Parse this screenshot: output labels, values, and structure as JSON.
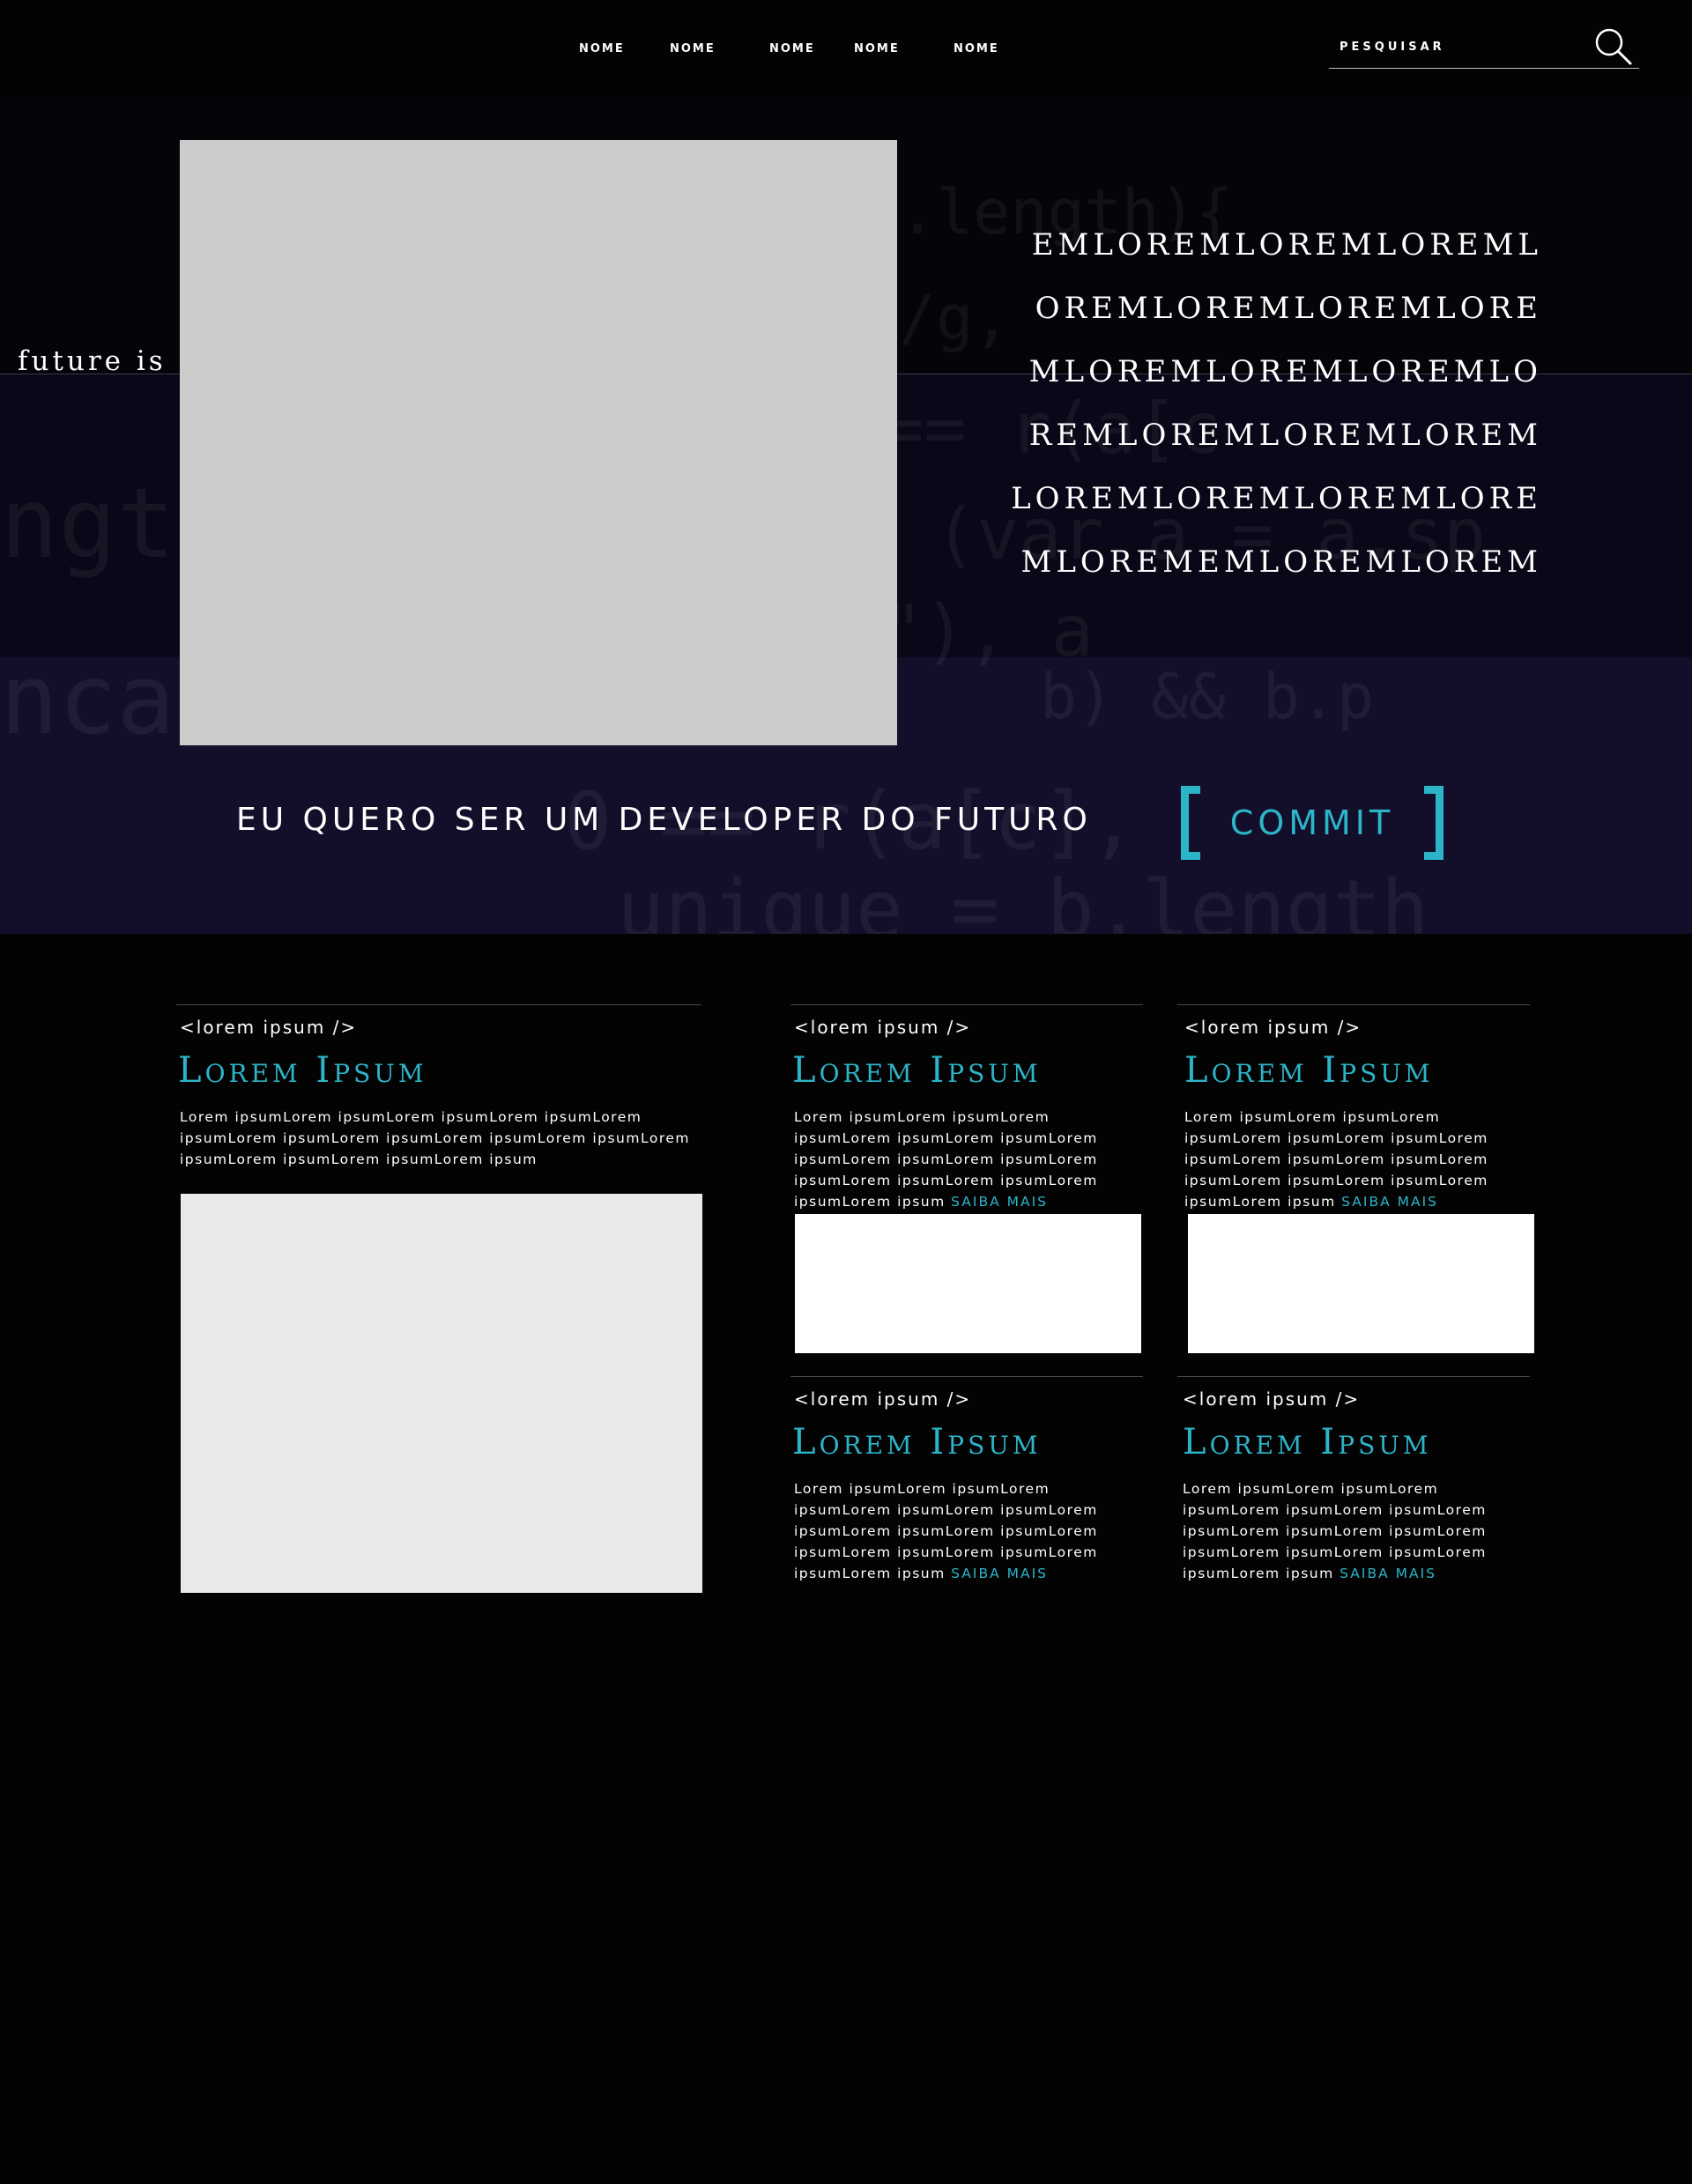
{
  "nav": {
    "items": [
      {
        "label": "NOME"
      },
      {
        "label": "NOME"
      },
      {
        "label": "NOME"
      },
      {
        "label": "NOME"
      },
      {
        "label": "NOME"
      }
    ],
    "search_placeholder": "PESQUISAR"
  },
  "hero": {
    "side_text": "future is",
    "lines": [
      "EMLOREMLOREMLOREML",
      "OREMLOREMLOREMLORE",
      "MLOREMLOREMLOREMLO",
      "REMLOREMLOREMLOREM",
      "LOREMLOREMLOREMLORE",
      "MLOREMEMLOREMLOREM"
    ],
    "cta_text": "EU QUERO SER UM DEVELOPER DO FUTURO",
    "commit_label": "COMMIT"
  },
  "cards": {
    "featured": {
      "tag": "<lorem ipsum />",
      "title": "Lorem Ipsum",
      "body_lines": [
        "Lorem ipsumLorem ipsumLorem ipsumLorem ipsumLorem",
        "ipsumLorem ipsumLorem ipsumLorem ipsumLorem ipsumLorem",
        "ipsumLorem ipsumLorem ipsumLorem ipsum"
      ]
    },
    "small": [
      {
        "tag": "<lorem ipsum />",
        "title": "Lorem Ipsum",
        "body_lines": [
          "Lorem ipsumLorem ipsumLorem",
          "ipsumLorem ipsumLorem ipsumLorem",
          "ipsumLorem ipsumLorem ipsumLorem",
          "ipsumLorem ipsumLorem ipsumLorem",
          "ipsumLorem ipsum"
        ],
        "link": "SAIBA MAIS"
      },
      {
        "tag": "<lorem ipsum />",
        "title": "Lorem Ipsum",
        "body_lines": [
          "Lorem ipsumLorem ipsumLorem",
          "ipsumLorem ipsumLorem ipsumLorem",
          "ipsumLorem ipsumLorem ipsumLorem",
          "ipsumLorem ipsumLorem ipsumLorem",
          "ipsumLorem ipsum"
        ],
        "link": "SAIBA MAIS"
      },
      {
        "tag": "<lorem ipsum />",
        "title": "Lorem Ipsum",
        "body_lines": [
          "Lorem ipsumLorem ipsumLorem",
          "ipsumLorem ipsumLorem ipsumLorem",
          "ipsumLorem ipsumLorem ipsumLorem",
          "ipsumLorem ipsumLorem ipsumLorem",
          "ipsumLorem ipsum"
        ],
        "link": "SAIBA MAIS"
      },
      {
        "tag": "<lorem ipsum />",
        "title": "Lorem Ipsum",
        "body_lines": [
          "Lorem ipsumLorem ipsumLorem",
          "ipsumLorem ipsumLorem ipsumLorem",
          "ipsumLorem ipsumLorem ipsumLorem",
          "ipsumLorem ipsumLorem ipsumLorem",
          "ipsumLorem ipsum"
        ],
        "link": "SAIBA MAIS"
      }
    ]
  },
  "colors": {
    "accent": "#2cb4c8",
    "background": "#030304",
    "hero_band": "#130f2b",
    "placeholder_gray": "#cccccc",
    "placeholder_light": "#eaeaea"
  },
  "icons": {
    "search": "search-icon"
  }
}
